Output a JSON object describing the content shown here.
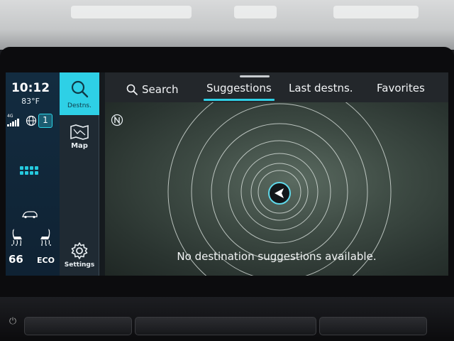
{
  "status": {
    "time": "10:12",
    "temperature": "83°F",
    "network": "4G",
    "badge_count": "1",
    "seat_left_value": "66",
    "seat_right_value": "ECO"
  },
  "nav": {
    "destinations_label": "Destns.",
    "map_label": "Map",
    "settings_label": "Settings"
  },
  "tabs": {
    "search": "Search",
    "suggestions": "Suggestions",
    "last_destinations": "Last destns.",
    "favorites": "Favorites",
    "active": "Suggestions"
  },
  "map": {
    "message": "No destination suggestions available."
  },
  "colors": {
    "accent": "#2ed0e6"
  },
  "icons": [
    "search-icon",
    "map-icon",
    "gear-icon",
    "north-compass-icon",
    "signal-icon",
    "globe-icon",
    "apps-grid-icon",
    "car-icon",
    "seat-heat-icon",
    "position-arrow-icon",
    "power-icon"
  ]
}
